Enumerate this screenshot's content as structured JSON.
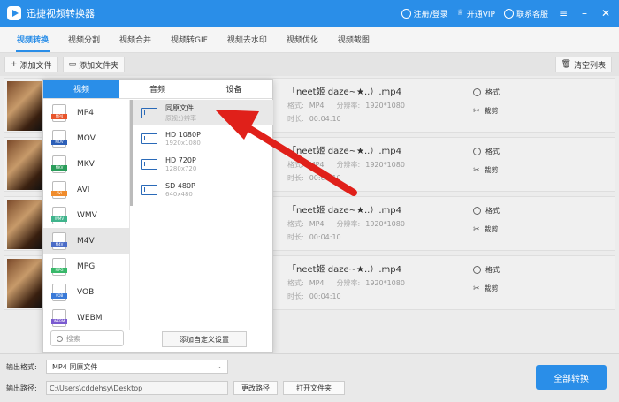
{
  "app": {
    "title": "迅捷视频转换器"
  },
  "titlebar": {
    "login": "注册/登录",
    "vip": "开通VIP",
    "service": "联系客服"
  },
  "tabs": [
    "视频转换",
    "视频分割",
    "视频合并",
    "视频转GIF",
    "视频去水印",
    "视频优化",
    "视频截图"
  ],
  "toolbar": {
    "add_file": "添加文件",
    "add_folder": "添加文件夹",
    "clear": "清空列表"
  },
  "files": [
    {
      "name": "「neet姬 daze~★..）.mp4",
      "format_label": "格式:",
      "format": "MP4",
      "res_label": "分辨率:",
      "res": "1920*1080",
      "dur_label": "时长:",
      "duration": "00:04:10",
      "action_format": "格式",
      "action_cut": "裁剪"
    },
    {
      "name": "「neet姬 daze~★..）.mp4",
      "format_label": "格式:",
      "format": "MP4",
      "res_label": "分辨率:",
      "res": "1920*1080",
      "dur_label": "时长:",
      "duration": "00:04:10",
      "action_format": "格式",
      "action_cut": "裁剪"
    },
    {
      "name": "「neet姬 daze~★..）.mp4",
      "format_label": "格式:",
      "format": "MP4",
      "res_label": "分辨率:",
      "res": "1920*1080",
      "dur_label": "时长:",
      "duration": "00:04:10",
      "action_format": "格式",
      "action_cut": "裁剪"
    },
    {
      "name": "「neet姬 daze~★..）.mp4",
      "format_label": "格式:",
      "format": "MP4",
      "res_label": "分辨率:",
      "res": "1920*1080",
      "dur_label": "时长:",
      "duration": "00:04:10",
      "action_format": "格式",
      "action_cut": "裁剪"
    }
  ],
  "panel": {
    "tabs": [
      "视频",
      "音频",
      "设备"
    ],
    "formats": [
      {
        "label": "MP4",
        "color": "#e8552c"
      },
      {
        "label": "MOV",
        "color": "#2c5fb8"
      },
      {
        "label": "MKV",
        "color": "#2a9d5a"
      },
      {
        "label": "AVI",
        "color": "#f08c2c"
      },
      {
        "label": "WMV",
        "color": "#3fb48c"
      },
      {
        "label": "M4V",
        "color": "#4a6cc8"
      },
      {
        "label": "MPG",
        "color": "#38b86a"
      },
      {
        "label": "VOB",
        "color": "#3a7ad8"
      },
      {
        "label": "WEBM",
        "color": "#7a5ad0"
      }
    ],
    "selected_format": "M4V",
    "resolutions": [
      {
        "title": "同原文件",
        "sub": "原视分辨率"
      },
      {
        "title": "HD 1080P",
        "sub": "1920x1080"
      },
      {
        "title": "HD 720P",
        "sub": "1280x720"
      },
      {
        "title": "SD 480P",
        "sub": "640x480"
      }
    ],
    "search_placeholder": "搜索",
    "custom_button": "添加自定义设置"
  },
  "bottom": {
    "format_label": "输出格式:",
    "format_value": "MP4  同原文件",
    "path_label": "输出路径:",
    "path_value": "C:\\Users\\cddehsy\\Desktop",
    "change_path": "更改路径",
    "open_folder": "打开文件夹",
    "convert_all": "全部转换"
  },
  "colors": {
    "accent": "#2a8ee8",
    "annotation_arrow": "#e0201a"
  }
}
